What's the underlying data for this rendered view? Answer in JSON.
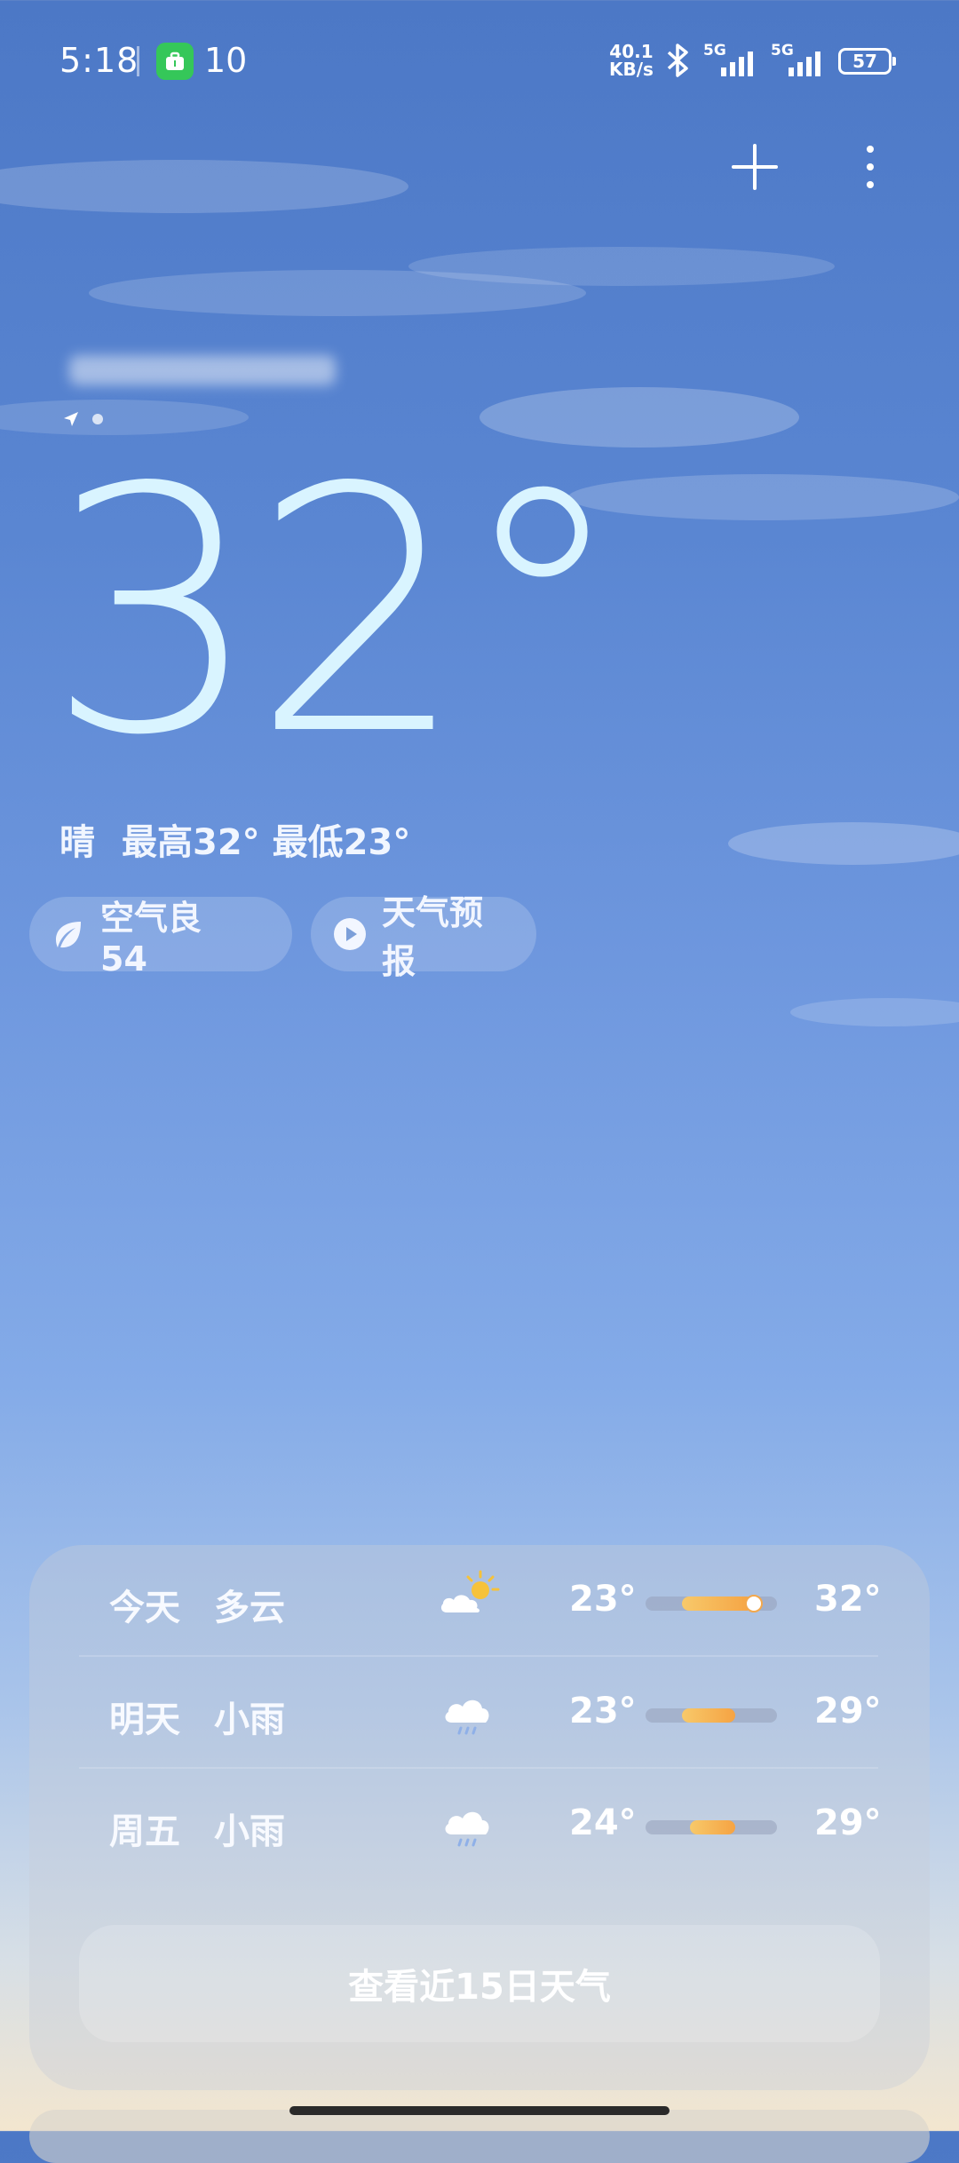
{
  "status_bar": {
    "time": "5:18",
    "notification_count": "10",
    "net_speed_value": "40.1",
    "net_speed_unit": "KB/s",
    "sim1_label": "5G",
    "sim2_label": "5G",
    "battery": "57"
  },
  "location": {
    "city_name": ""
  },
  "current": {
    "temperature": "32°",
    "condition": "晴",
    "high": "最高32°",
    "low": "最低23°"
  },
  "chips": {
    "air_quality": "空气良 54",
    "forecast_video": "天气预报"
  },
  "forecast": [
    {
      "day": "今天",
      "condition": "多云",
      "icon": "partly-cloudy-icon",
      "low": "23°",
      "high": "32°",
      "range": [
        0.28,
        0.82
      ],
      "current_marker": 0.82
    },
    {
      "day": "明天",
      "condition": "小雨",
      "icon": "light-rain-icon",
      "low": "23°",
      "high": "29°",
      "range": [
        0.28,
        0.68
      ]
    },
    {
      "day": "周五",
      "condition": "小雨",
      "icon": "light-rain-icon",
      "low": "24°",
      "high": "29°",
      "range": [
        0.34,
        0.68
      ]
    }
  ],
  "view_15_days": "查看近15日天气",
  "colors": {
    "sky_top": "#4c78c6",
    "sky_bottom": "#f3e6cf",
    "temp_text": "#d9f4ff",
    "bar_fill": "#f6a343"
  }
}
